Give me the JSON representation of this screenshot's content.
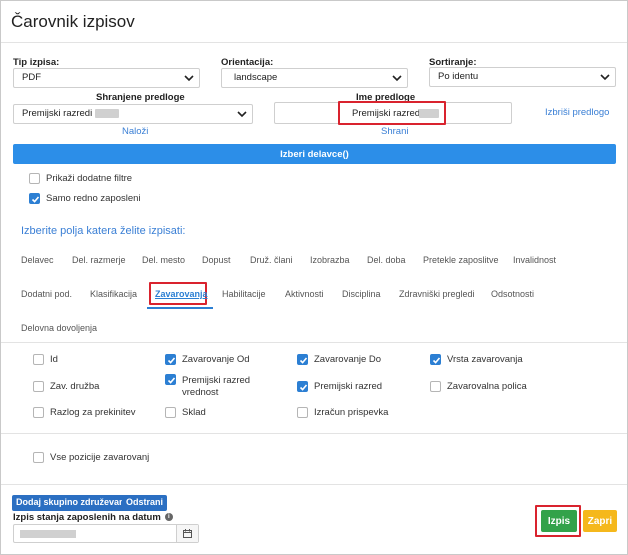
{
  "dialog": {
    "title": "Čarovnik izpisov"
  },
  "fields": {
    "tip_izpisa": {
      "label": "Tip izpisa:",
      "value": "PDF"
    },
    "orientacija": {
      "label": "Orientacija:",
      "value": "landscape"
    },
    "sortiranje": {
      "label": "Sortiranje:",
      "value": "Po identu"
    },
    "shranjene_predloge": {
      "label": "Shranjene predloge",
      "value": "Premijski razredi"
    },
    "ime_predloge": {
      "label": "Ime predloge",
      "value": "Premijski razredi"
    }
  },
  "links": {
    "nalozi": "Naloži",
    "shrani": "Shrani",
    "izbrisi": "Izbriši predlogo"
  },
  "buttons": {
    "izberi_delavce": "Izberi delavce()",
    "dodaj_skupino": "Dodaj skupino združevanja",
    "odstrani": "Odstrani",
    "izpis": "Izpis",
    "zapri": "Zapri"
  },
  "filters": [
    {
      "label": "Prikaži dodatne filtre",
      "checked": false
    },
    {
      "label": "Samo redno zaposleni",
      "checked": true
    }
  ],
  "section_title": "Izberite polja katera želite izpisati:",
  "tabs": [
    "Delavec",
    "Del. razmerje",
    "Del. mesto",
    "Dopust",
    "Druž. člani",
    "Izobrazba",
    "Del. doba",
    "Pretekle zaposlitve",
    "Invalidnost",
    "Dodatni pod.",
    "Klasifikacija",
    "Zavarovanja",
    "Habilitacije",
    "Aktivnosti",
    "Disciplina",
    "Zdravniški pregledi",
    "Odsotnosti",
    "Delovna dovoljenja"
  ],
  "active_tab": "Zavarovanja",
  "fields_list": [
    {
      "label": "Id",
      "checked": false
    },
    {
      "label": "Zavarovanje Od",
      "checked": true
    },
    {
      "label": "Zavarovanje Do",
      "checked": true
    },
    {
      "label": "Vrsta zavarovanja",
      "checked": true
    },
    {
      "label": "Zav. družba",
      "checked": false
    },
    {
      "label": "Premijski razred vrednost",
      "checked": true
    },
    {
      "label": "Premijski razred",
      "checked": true
    },
    {
      "label": "Zavarovalna polica",
      "checked": false
    },
    {
      "label": "Razlog za prekinitev",
      "checked": false
    },
    {
      "label": "Sklad",
      "checked": false
    },
    {
      "label": "Izračun prispevka",
      "checked": false
    }
  ],
  "all_positions": {
    "label": "Vse pozicije zavarovanj",
    "checked": false
  },
  "izpis_stanja": {
    "label": "Izpis stanja zaposlenih na datum"
  },
  "colors": {
    "primary": "#2c8ee8",
    "link": "#3a7fd5",
    "highlight": "#d9232e",
    "green": "#33a24a",
    "yellow": "#f5b81c"
  }
}
